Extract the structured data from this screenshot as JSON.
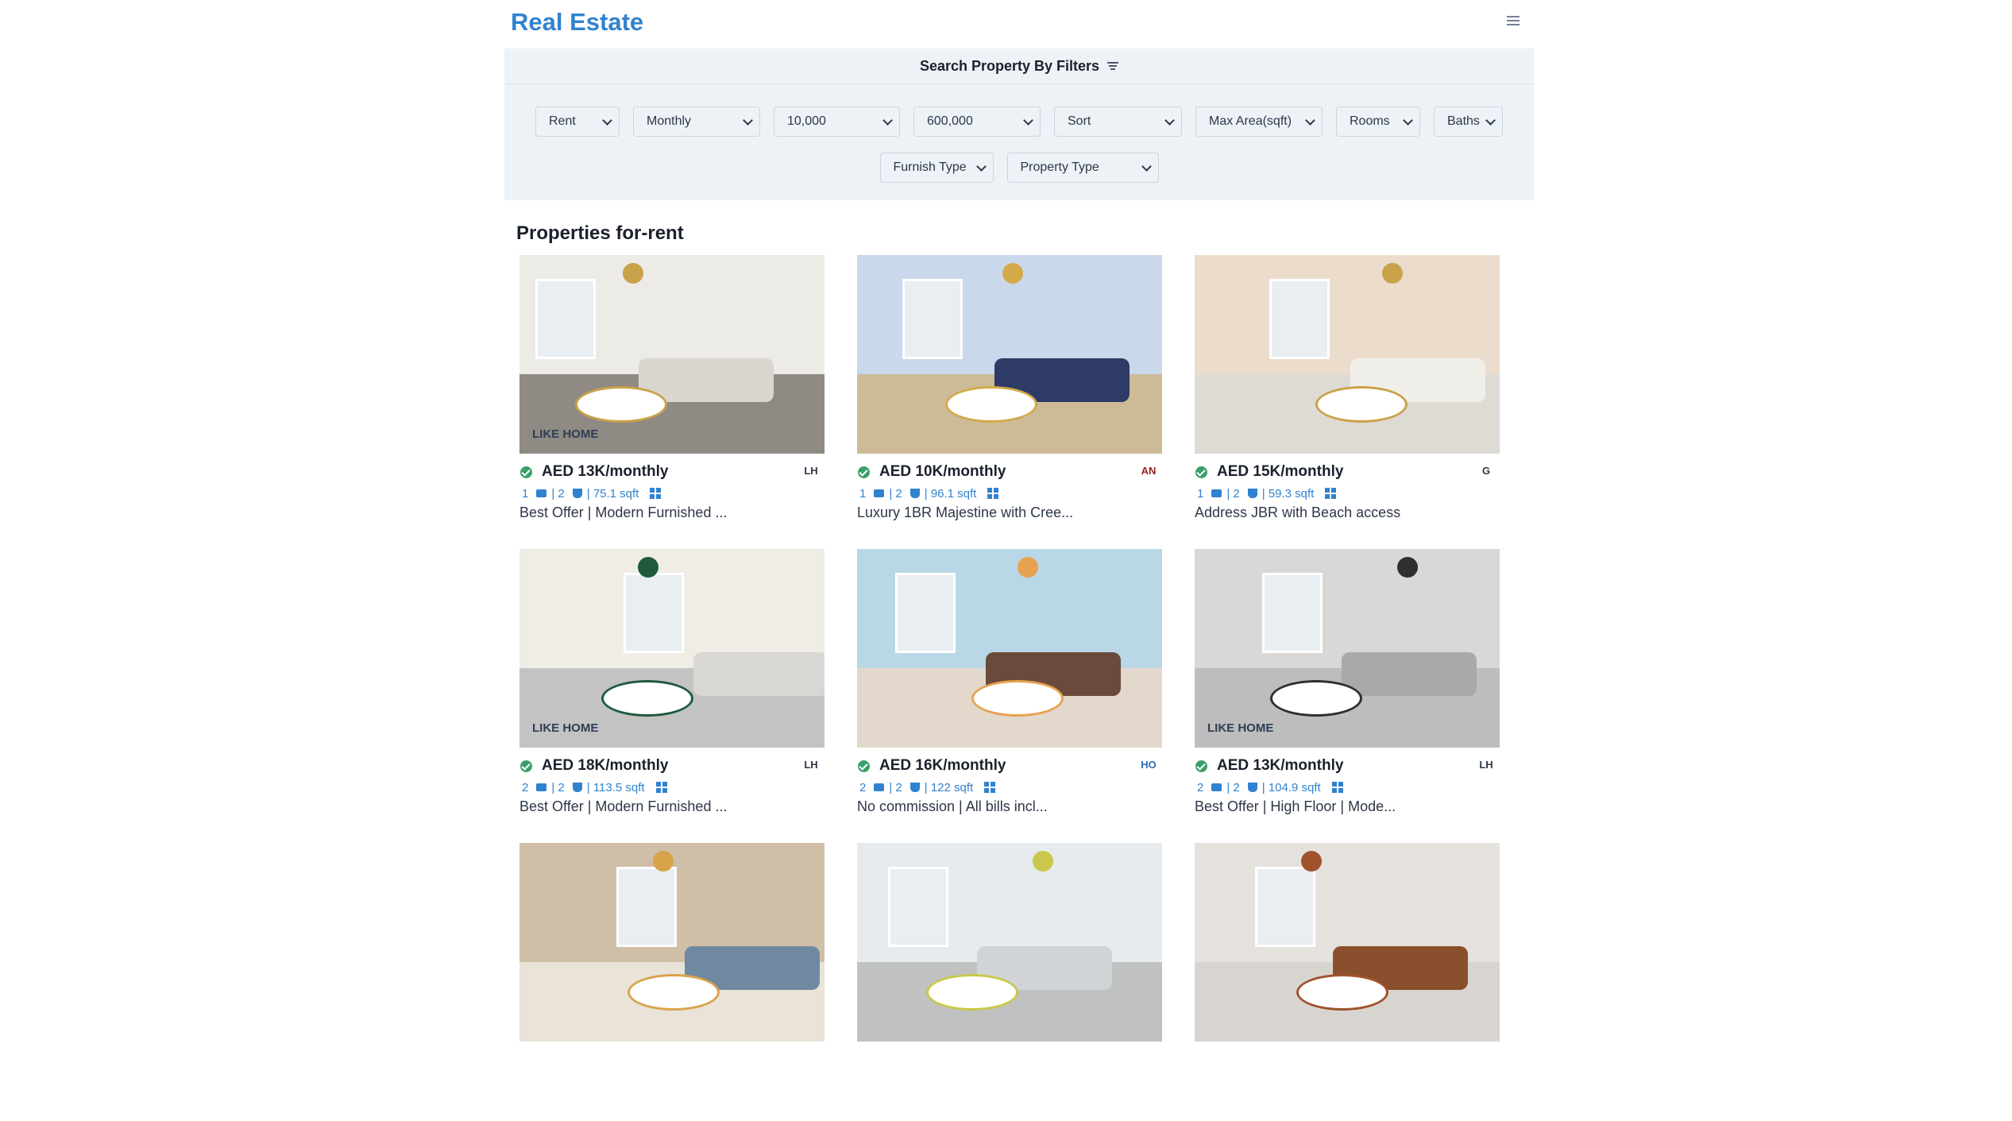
{
  "header": {
    "brand": "Real Estate"
  },
  "filters": {
    "heading": "Search Property By Filters",
    "row1": [
      {
        "value": "Rent",
        "width": 106
      },
      {
        "value": "Monthly",
        "width": 160
      },
      {
        "value": "10,000",
        "width": 159
      },
      {
        "value": "600,000",
        "width": 160
      },
      {
        "value": "Sort",
        "width": 161
      },
      {
        "value": "Max Area(sqft)",
        "width": 160
      },
      {
        "value": "Rooms",
        "width": 106
      },
      {
        "value": "Baths",
        "width": 87
      }
    ],
    "row2": [
      {
        "value": "Furnish Type",
        "width": 143
      },
      {
        "value": "Property Type",
        "width": 191
      }
    ]
  },
  "section_title": "Properties for-rent",
  "listings": [
    {
      "price": "AED 13K/monthly",
      "rooms": "1",
      "baths": "| 2",
      "area": "| 75.1 sqft",
      "title": "Best Offer | Modern Furnished ...",
      "agency": "LH",
      "watermark": "LIKE HOME",
      "palette": [
        "#ecebe6",
        "#d9d6d0",
        "#8f8a83",
        "#c9a24a"
      ]
    },
    {
      "price": "AED 10K/monthly",
      "rooms": "1",
      "baths": "| 2",
      "area": "| 96.1 sqft",
      "title": "Luxury 1BR Majestine with Cree...",
      "agency": "AN",
      "watermark": "",
      "palette": [
        "#c9d8ea",
        "#2d3b66",
        "#cdbb98",
        "#d4a94a"
      ]
    },
    {
      "price": "AED 15K/monthly",
      "rooms": "1",
      "baths": "| 2",
      "area": "| 59.3 sqft",
      "title": "Address JBR with Beach access",
      "agency": "G",
      "watermark": "",
      "palette": [
        "#ecdccb",
        "#f1efea",
        "#dedbd4",
        "#c9a24a"
      ]
    },
    {
      "price": "AED 18K/monthly",
      "rooms": "2",
      "baths": "| 2",
      "area": "| 113.5 sqft",
      "title": "Best Offer | Modern Furnished ...",
      "agency": "LH",
      "watermark": "LIKE HOME",
      "palette": [
        "#f0ede6",
        "#d8d7d3",
        "#c3c3c3",
        "#1f5a3e"
      ]
    },
    {
      "price": "AED 16K/monthly",
      "rooms": "2",
      "baths": "| 2",
      "area": "| 122 sqft",
      "title": "No commission | All bills incl...",
      "agency": "HO",
      "watermark": "",
      "palette": [
        "#b9d7e6",
        "#6a4a3a",
        "#e2d8cc",
        "#e7a24f"
      ]
    },
    {
      "price": "AED 13K/monthly",
      "rooms": "2",
      "baths": "| 2",
      "area": "| 104.9 sqft",
      "title": "Best Offer | High Floor | Mode...",
      "agency": "LH",
      "watermark": "LIKE HOME",
      "palette": [
        "#d9d8d6",
        "#a9a9ab",
        "#bdbdbd",
        "#2f2f2f"
      ]
    },
    {
      "price": "",
      "rooms": "",
      "baths": "",
      "area": "",
      "title": "",
      "agency": "",
      "watermark": "",
      "palette": [
        "#cfbfa6",
        "#6f8aa0",
        "#e9e3d8",
        "#d9a34a"
      ]
    },
    {
      "price": "",
      "rooms": "",
      "baths": "",
      "area": "",
      "title": "",
      "agency": "",
      "watermark": "",
      "palette": [
        "#e8ebed",
        "#d0d4d6",
        "#bfc2c0",
        "#c9c84a"
      ]
    },
    {
      "price": "",
      "rooms": "",
      "baths": "",
      "area": "",
      "title": "",
      "agency": "",
      "watermark": "",
      "palette": [
        "#e5e2de",
        "#8a4f2c",
        "#d8d5d0",
        "#a0522d"
      ]
    }
  ]
}
